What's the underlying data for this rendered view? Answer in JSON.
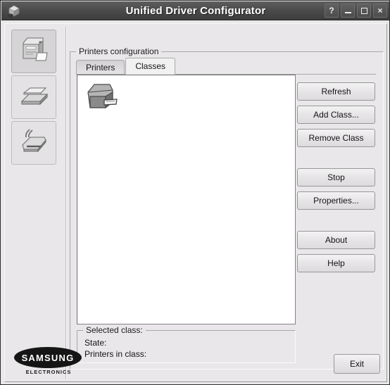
{
  "window": {
    "title": "Unified Driver Configurator",
    "app_icon": "printer-cube-icon",
    "controls": {
      "help_label": "?",
      "minimize_label": "_",
      "maximize_label": "□",
      "close_label": "×"
    },
    "colors": {
      "titlebar": "#4c4c4c",
      "title_text": "#ffffff",
      "panel_background": "#e9e7e9",
      "list_background": "#ffffff",
      "border": "#a9a8a9"
    }
  },
  "sidebar": {
    "items": [
      {
        "name": "printers-configuration",
        "icon": "printer-icon",
        "selected": true
      },
      {
        "name": "scanners-configuration",
        "icon": "scanner-icon",
        "selected": false
      },
      {
        "name": "ports-configuration",
        "icon": "port-device-icon",
        "selected": false
      }
    ]
  },
  "main": {
    "group_title": "Printers configuration",
    "tabs": [
      {
        "label": "Printers",
        "active": false
      },
      {
        "label": "Classes",
        "active": true
      }
    ],
    "list": {
      "items": [
        {
          "icon": "printer-class-icon",
          "label": ""
        }
      ]
    },
    "buttons": [
      {
        "id": "refresh",
        "label": "Refresh"
      },
      {
        "id": "add-class",
        "label": "Add Class..."
      },
      {
        "id": "remove-class",
        "label": "Remove Class"
      },
      {
        "id": "stop",
        "label": "Stop"
      },
      {
        "id": "properties",
        "label": "Properties..."
      },
      {
        "id": "about",
        "label": "About"
      },
      {
        "id": "help",
        "label": "Help"
      }
    ],
    "selected_class": {
      "group_title": "Selected class:",
      "state_label": "State:",
      "state_value": "",
      "printers_label": "Printers in class:",
      "printers_value": ""
    }
  },
  "footer": {
    "brand": "SAMSUNG",
    "brand_sub": "ELECTRONICS",
    "exit_label": "Exit"
  }
}
